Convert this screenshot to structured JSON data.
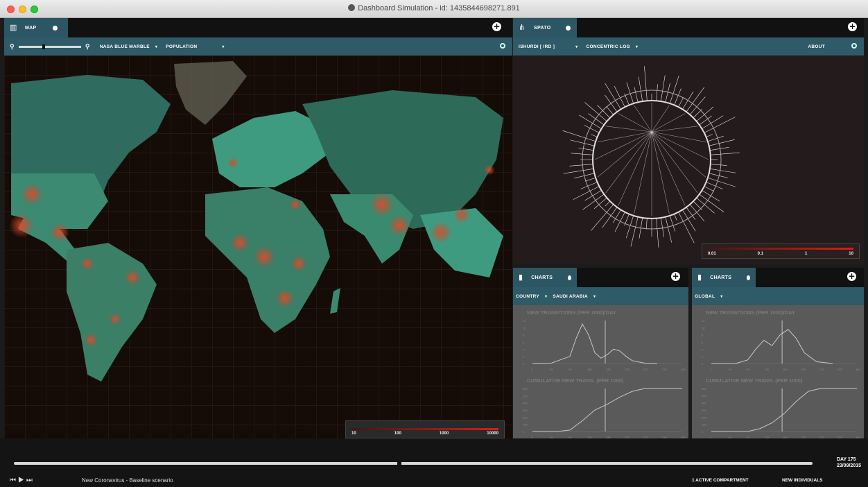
{
  "window": {
    "title": "Dashboard Simulation - id: 1435844698271.891"
  },
  "map_panel": {
    "tab_label": "MAP",
    "basemap": "NASA BLUE MARBLE",
    "layer": "POPULATION",
    "legend_ticks": [
      "10",
      "100",
      "1000",
      "10000"
    ]
  },
  "spato_panel": {
    "tab_label": "SPATO",
    "selector": "ISHURDI [ IRD ]",
    "layout": "CONCENTRIC LOG",
    "about": "ABOUT",
    "legend_ticks": [
      "0.01",
      "0.1",
      "1",
      "10"
    ]
  },
  "charts_left": {
    "tab_label": "CHARTS",
    "scope": "COUNTRY",
    "country": "SAUDI ARABIA",
    "chart1_title": "NEW TRANSITIONS (PER 1000)/DAY",
    "chart2_title": "CUMULATIVE NEW TRANS. (PER 1000)"
  },
  "charts_right": {
    "tab_label": "CHARTS",
    "scope": "GLOBAL",
    "chart1_title": "NEW TRANSITIONS (PER 1000)/DAY",
    "chart2_title": "CUMULATIVE NEW TRANS. (PER 1000)"
  },
  "chart_data": [
    {
      "type": "line",
      "title": "NEW TRANSITIONS (PER 1000)/DAY",
      "scope": "SAUDI ARABIA",
      "x": [
        0,
        45,
        90,
        105,
        120,
        135,
        150,
        165,
        180,
        195,
        210,
        225,
        240,
        270,
        300
      ],
      "y": [
        0,
        0.1,
        2,
        7,
        11,
        8,
        3,
        1.5,
        2.5,
        4,
        3.5,
        2,
        0.8,
        0.1,
        0
      ],
      "y_ticks": [
        "0",
        "2",
        "4",
        "6",
        "8",
        "10",
        "12"
      ],
      "x_ticks": [
        "0",
        "45",
        "90",
        "135",
        "180",
        "225",
        "270",
        "315",
        "360"
      ]
    },
    {
      "type": "line",
      "title": "CUMULATIVE NEW TRANS. (PER 1000)",
      "scope": "SAUDI ARABIA",
      "x": [
        0,
        60,
        90,
        120,
        150,
        180,
        210,
        240,
        270,
        300,
        360
      ],
      "y": [
        0,
        0,
        20,
        150,
        300,
        380,
        480,
        560,
        600,
        600,
        600
      ],
      "y_ticks": [
        "0",
        "100",
        "200",
        "300",
        "400",
        "500",
        "600"
      ],
      "x_ticks": [
        "0",
        "45",
        "90",
        "135",
        "180",
        "225",
        "270",
        "315",
        "360"
      ]
    },
    {
      "type": "line",
      "title": "NEW TRANSITIONS (PER 1000)/DAY",
      "scope": "GLOBAL",
      "x": [
        0,
        60,
        90,
        110,
        130,
        150,
        170,
        190,
        210,
        230,
        260,
        300
      ],
      "y": [
        0,
        0,
        1,
        4,
        6.5,
        5,
        8,
        9.5,
        7,
        3,
        0.5,
        0
      ],
      "y_ticks": [
        "0",
        "2",
        "4",
        "6",
        "8",
        "10",
        "12"
      ],
      "x_ticks": [
        "0",
        "45",
        "90",
        "135",
        "180",
        "225",
        "270",
        "315",
        "360"
      ]
    },
    {
      "type": "line",
      "title": "CUMULATIVE NEW TRANS. (PER 1000)",
      "scope": "GLOBAL",
      "x": [
        0,
        90,
        120,
        150,
        180,
        210,
        240,
        270,
        300,
        360
      ],
      "y": [
        0,
        0,
        40,
        120,
        250,
        420,
        560,
        620,
        630,
        630
      ],
      "y_ticks": [
        "0",
        "100",
        "200",
        "300",
        "400",
        "500",
        "600"
      ],
      "x_ticks": [
        "0",
        "45",
        "90",
        "135",
        "180",
        "225",
        "270",
        "315",
        "360"
      ]
    }
  ],
  "bottom": {
    "scenario": "New Coronavirus - Baseline scenario",
    "day_label": "DAY 175",
    "date": "23/09/2015",
    "compartments": "1 ACTIVE COMPARTMENT",
    "individuals": "NEW INDIVIDUALS",
    "progress": 0.48
  },
  "colors": {
    "accent": "#2f5a68",
    "hot": "#d91c1c",
    "land": "#3a8a78"
  }
}
